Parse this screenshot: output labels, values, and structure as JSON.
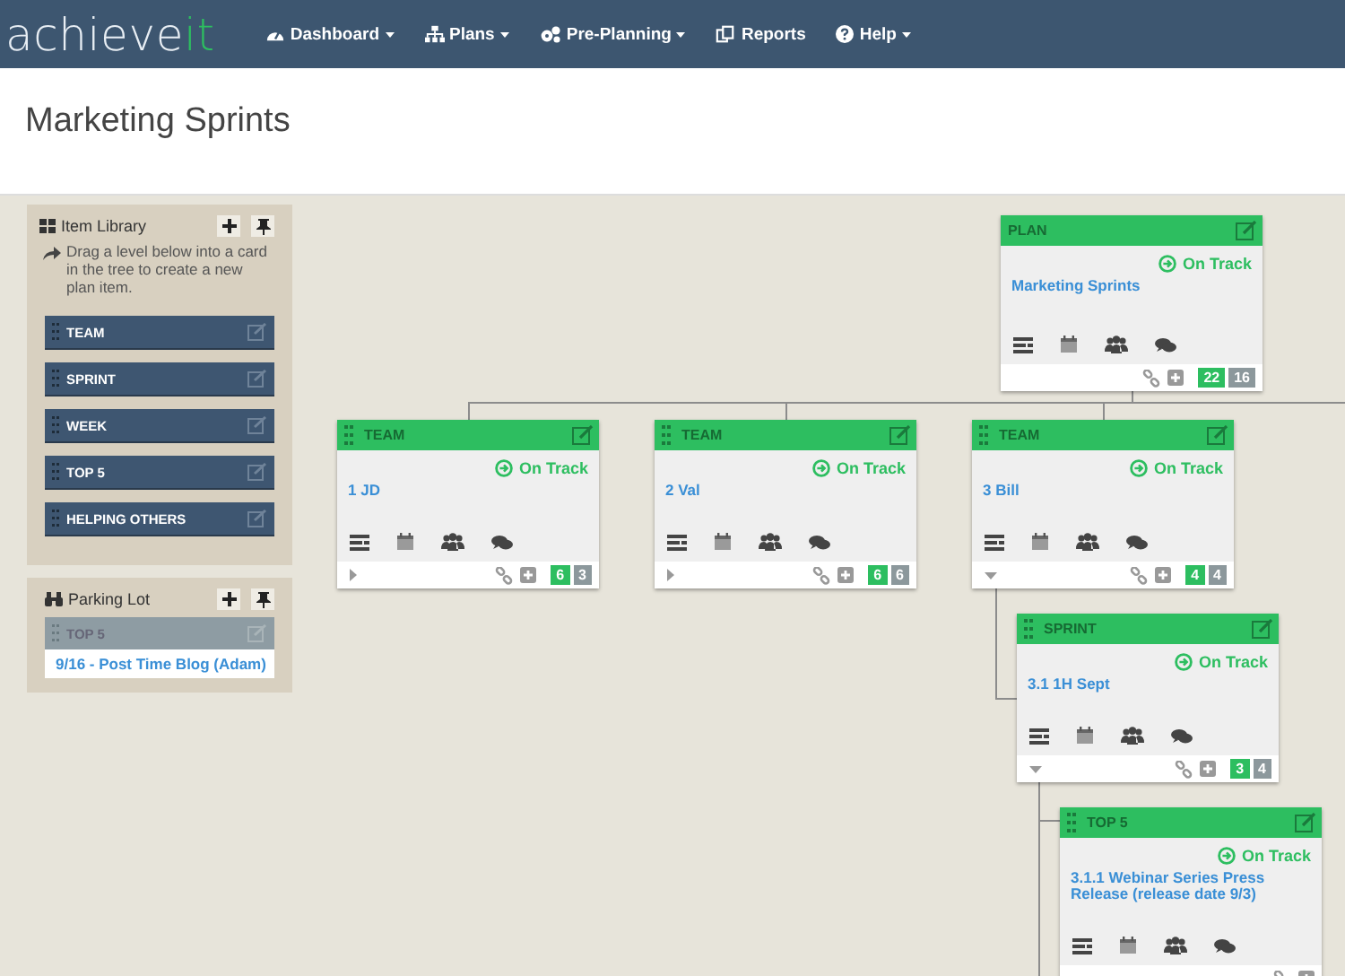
{
  "nav": {
    "logo": {
      "main": "achieve",
      "accent": "it"
    },
    "items": [
      {
        "label": "Dashboard",
        "dropdown": true
      },
      {
        "label": "Plans",
        "dropdown": true
      },
      {
        "label": "Pre-Planning",
        "dropdown": true
      },
      {
        "label": "Reports",
        "dropdown": false
      },
      {
        "label": "Help",
        "dropdown": true
      }
    ]
  },
  "page_title": "Marketing Sprints",
  "item_library": {
    "title": "Item Library",
    "hint": "Drag a level below into a card in the tree to create a new plan item.",
    "levels": [
      "TEAM",
      "SPRINT",
      "WEEK",
      "TOP 5",
      "HELPING OTHERS"
    ]
  },
  "parking_lot": {
    "title": "Parking Lot",
    "level": "TOP 5",
    "items": [
      "9/16 - Post Time Blog (Adam)"
    ]
  },
  "cards": [
    {
      "kind": "plan",
      "level": "PLAN",
      "status": "On Track",
      "title": "Marketing Sprints",
      "counts": [
        "22",
        "16"
      ]
    },
    {
      "kind": "item",
      "level": "TEAM",
      "status": "On Track",
      "title": "1 JD",
      "expanded": false,
      "counts": [
        "6",
        "3"
      ]
    },
    {
      "kind": "item",
      "level": "TEAM",
      "status": "On Track",
      "title": "2 Val",
      "expanded": false,
      "counts": [
        "6",
        "6"
      ]
    },
    {
      "kind": "item",
      "level": "TEAM",
      "status": "On Track",
      "title": "3 Bill",
      "expanded": true,
      "counts": [
        "4",
        "4"
      ]
    },
    {
      "kind": "item",
      "level": "SPRINT",
      "status": "On Track",
      "title": "3.1 1H Sept",
      "expanded": true,
      "counts": [
        "3",
        "4"
      ]
    },
    {
      "kind": "item",
      "level": "TOP 5",
      "status": "On Track",
      "title": "3.1.1 Webinar Series Press Release (release date 9/3)"
    }
  ]
}
